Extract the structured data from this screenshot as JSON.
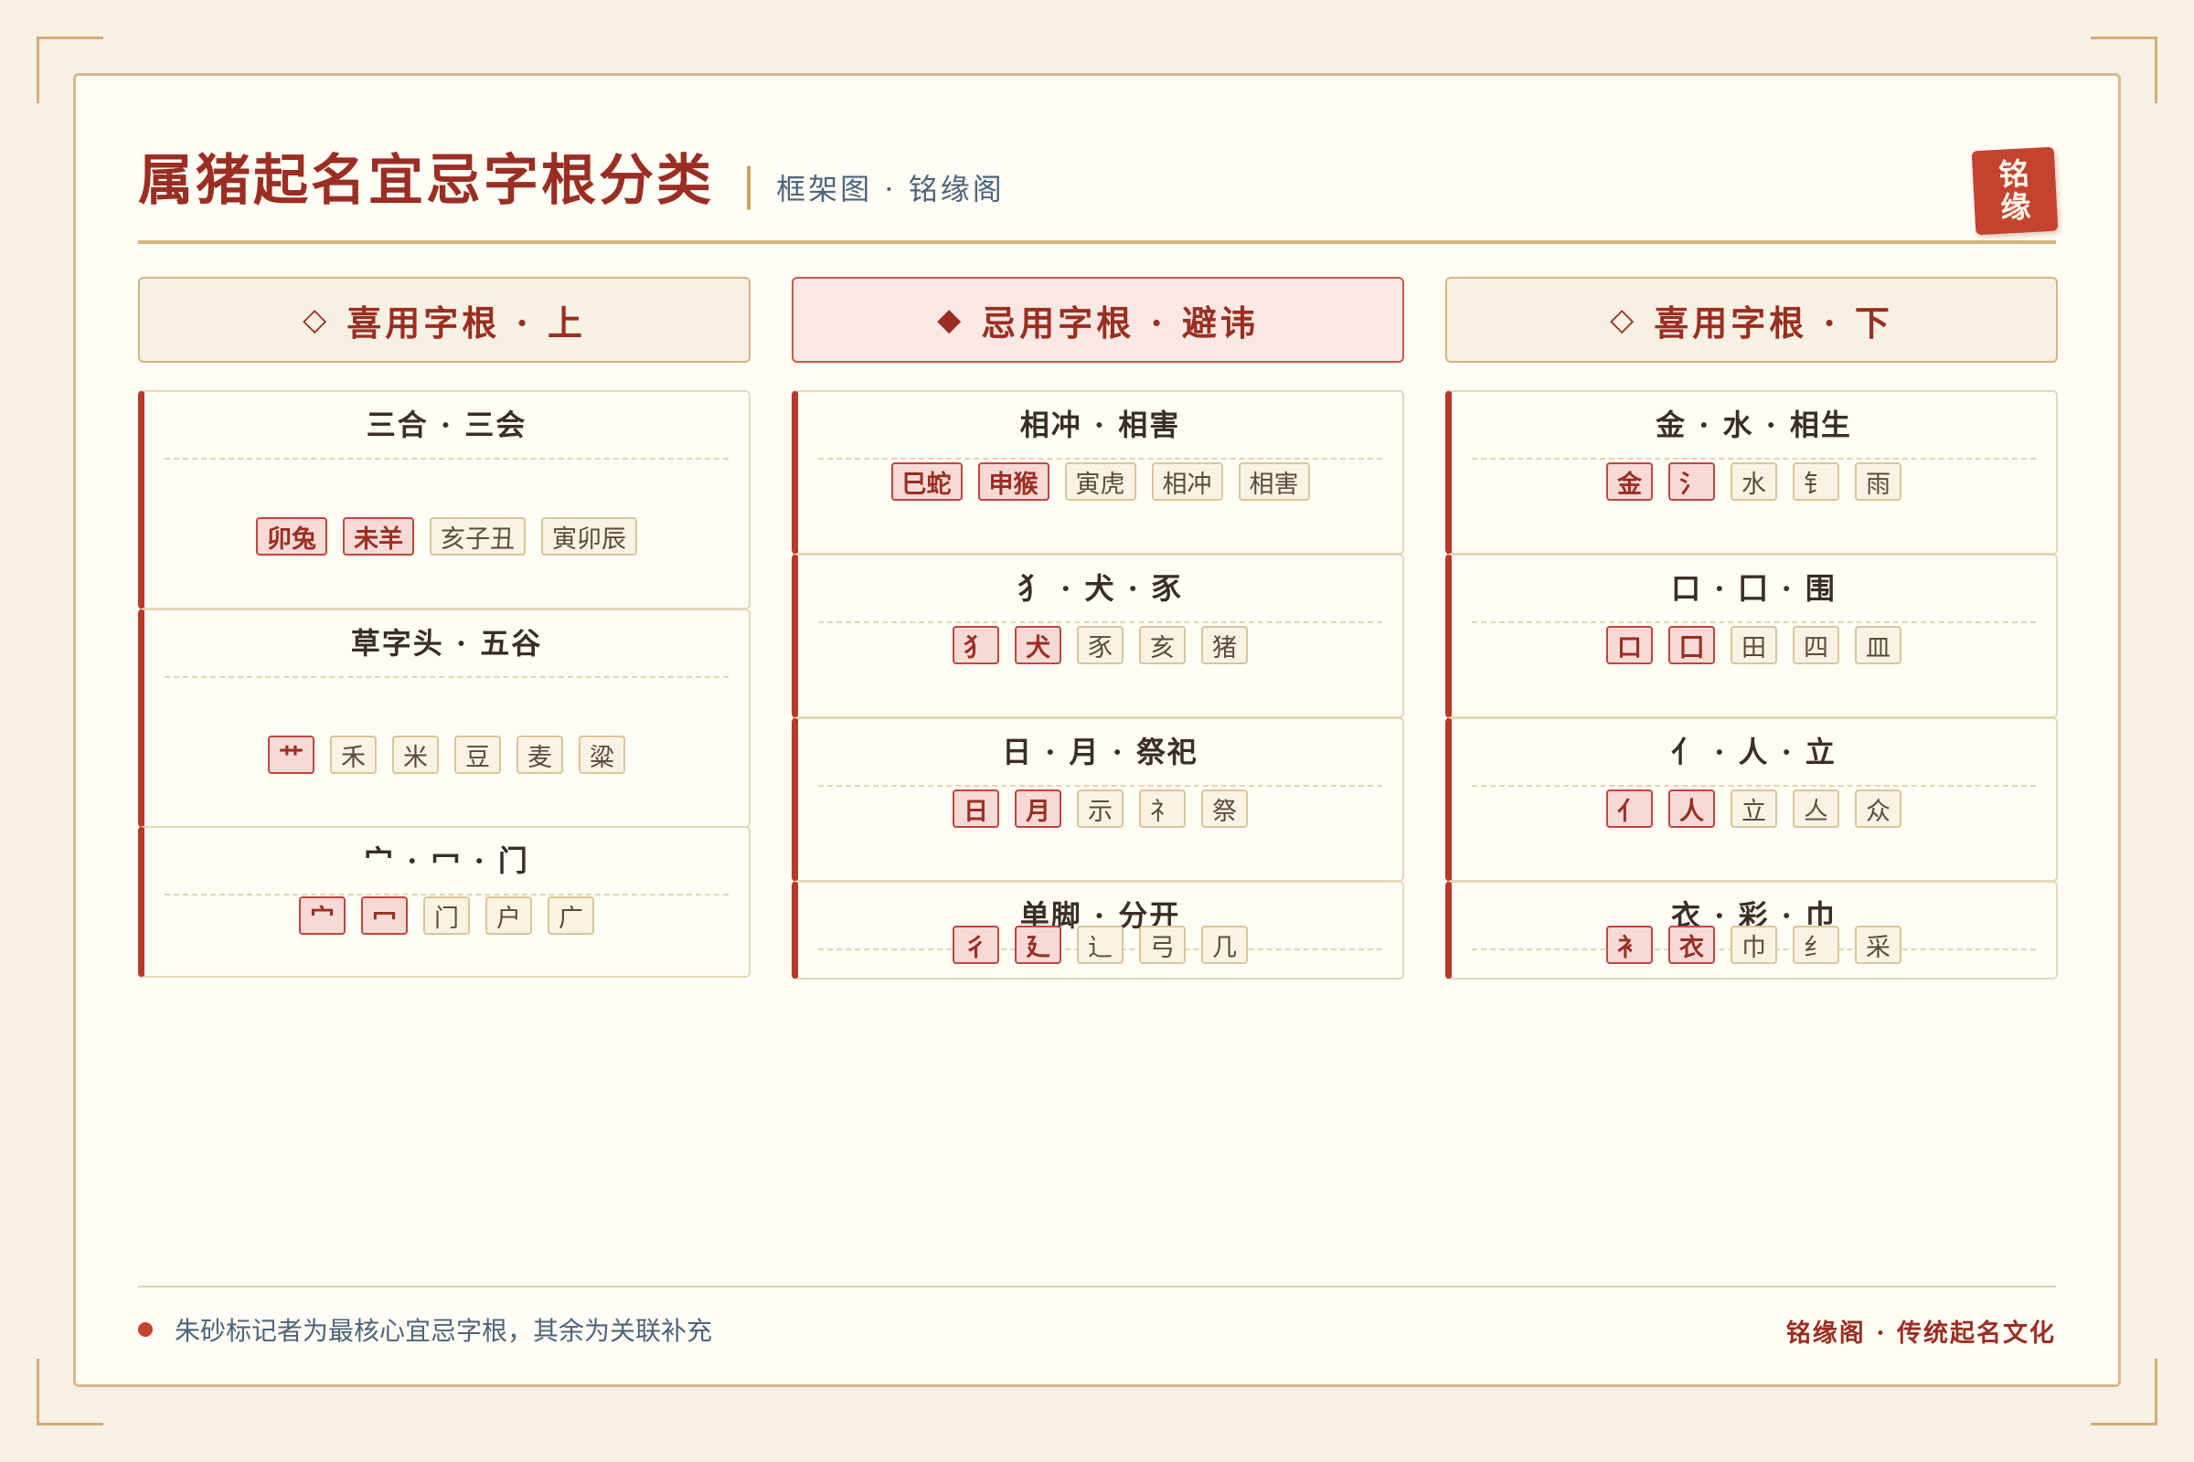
{
  "header": {
    "title": "属猪起名宜忌字根分类",
    "separator": "|",
    "subtitle": "框架图 · 铭缘阁",
    "seal": "铭缘"
  },
  "columns": [
    {
      "heading": "喜用字根 · 上",
      "marker": "◇",
      "kind": "favorable",
      "cards": [
        {
          "title": "三合 · 三会",
          "chips": [
            {
              "t": "卯兔",
              "hot": true
            },
            {
              "t": "未羊",
              "hot": true
            },
            {
              "t": "亥子丑",
              "hot": false
            },
            {
              "t": "寅卯辰",
              "hot": false
            }
          ]
        },
        {
          "title": "草字头 · 五谷",
          "chips": [
            {
              "t": "艹",
              "hot": true
            },
            {
              "t": "禾",
              "hot": false
            },
            {
              "t": "米",
              "hot": false
            },
            {
              "t": "豆",
              "hot": false
            },
            {
              "t": "麦",
              "hot": false
            },
            {
              "t": "粱",
              "hot": false
            }
          ]
        },
        {
          "title": "宀 · 冖 · 门",
          "chips": [
            {
              "t": "宀",
              "hot": true
            },
            {
              "t": "冖",
              "hot": true
            },
            {
              "t": "门",
              "hot": false
            },
            {
              "t": "户",
              "hot": false
            },
            {
              "t": "广",
              "hot": false
            }
          ]
        }
      ]
    },
    {
      "heading": "忌用字根 · 避讳",
      "marker": "◆",
      "kind": "avoid",
      "cards": [
        {
          "title": "相冲 · 相害",
          "chips": [
            {
              "t": "巳蛇",
              "hot": true
            },
            {
              "t": "申猴",
              "hot": true
            },
            {
              "t": "寅虎",
              "hot": false
            },
            {
              "t": "相冲",
              "hot": false
            },
            {
              "t": "相害",
              "hot": false
            }
          ]
        },
        {
          "title": "犭 · 犬 · 豕",
          "chips": [
            {
              "t": "犭",
              "hot": true
            },
            {
              "t": "犬",
              "hot": true
            },
            {
              "t": "豕",
              "hot": false
            },
            {
              "t": "亥",
              "hot": false
            },
            {
              "t": "猪",
              "hot": false
            }
          ]
        },
        {
          "title": "日 · 月 · 祭祀",
          "chips": [
            {
              "t": "日",
              "hot": true
            },
            {
              "t": "月",
              "hot": true
            },
            {
              "t": "示",
              "hot": false
            },
            {
              "t": "礻",
              "hot": false
            },
            {
              "t": "祭",
              "hot": false
            }
          ]
        },
        {
          "title": "单脚 · 分开",
          "chips": [
            {
              "t": "彳",
              "hot": true
            },
            {
              "t": "廴",
              "hot": true
            },
            {
              "t": "辶",
              "hot": false
            },
            {
              "t": "弓",
              "hot": false
            },
            {
              "t": "几",
              "hot": false
            }
          ]
        }
      ]
    },
    {
      "heading": "喜用字根 · 下",
      "marker": "◇",
      "kind": "favorable",
      "cards": [
        {
          "title": "金 · 水 · 相生",
          "chips": [
            {
              "t": "金",
              "hot": true
            },
            {
              "t": "氵",
              "hot": true
            },
            {
              "t": "水",
              "hot": false
            },
            {
              "t": "钅",
              "hot": false
            },
            {
              "t": "雨",
              "hot": false
            }
          ]
        },
        {
          "title": "口 · 囗 · 围",
          "chips": [
            {
              "t": "口",
              "hot": true
            },
            {
              "t": "囗",
              "hot": true
            },
            {
              "t": "田",
              "hot": false
            },
            {
              "t": "四",
              "hot": false
            },
            {
              "t": "皿",
              "hot": false
            }
          ]
        },
        {
          "title": "亻 · 人 · 立",
          "chips": [
            {
              "t": "亻",
              "hot": true
            },
            {
              "t": "人",
              "hot": true
            },
            {
              "t": "立",
              "hot": false
            },
            {
              "t": "亼",
              "hot": false
            },
            {
              "t": "众",
              "hot": false
            }
          ]
        },
        {
          "title": "衣 · 彩 · 巾",
          "chips": [
            {
              "t": "衤",
              "hot": true
            },
            {
              "t": "衣",
              "hot": true
            },
            {
              "t": "巾",
              "hot": false
            },
            {
              "t": "纟",
              "hot": false
            },
            {
              "t": "采",
              "hot": false
            }
          ]
        }
      ]
    }
  ],
  "footer": {
    "note": "朱砂标记者为最核心宜忌字根，其余为关联补充",
    "brand": "铭缘阁 · 传统起名文化"
  },
  "colors": {
    "accent": "#9b2e22",
    "cinnabar": "#c3432f",
    "gold": "#d7b27b",
    "paper": "#fffdf5"
  }
}
